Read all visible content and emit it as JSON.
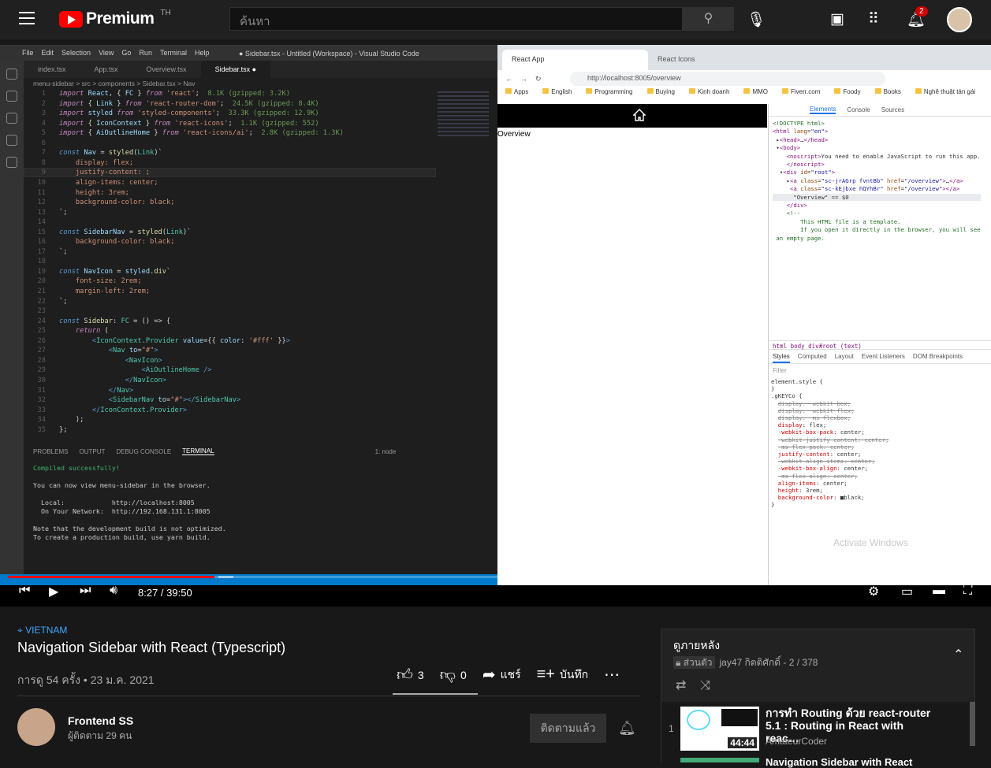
{
  "yt": {
    "logo_text": "Premium",
    "country_code": "TH",
    "search_placeholder": "ค้นหา",
    "notif_count": "2"
  },
  "vscode": {
    "menu": [
      "File",
      "Edit",
      "Selection",
      "View",
      "Go",
      "Run",
      "Terminal",
      "Help"
    ],
    "window_title": "● Sidebar.tsx - Untitled (Workspace) - Visual Studio Code",
    "tabs": [
      "index.tsx",
      "App.tsx",
      "Overview.tsx",
      "Sidebar.tsx ●"
    ],
    "breadcrumb": "menu-sidebar > src > components > Sidebar.tsx > Nav",
    "line_numbers": [
      "1",
      "2",
      "3",
      "4",
      "5",
      "6",
      "7",
      "8",
      "9",
      "10",
      "11",
      "12",
      "13",
      "14",
      "15",
      "16",
      "17",
      "18",
      "19",
      "20",
      "21",
      "22",
      "23",
      "24",
      "25",
      "26",
      "27",
      "28",
      "29",
      "30",
      "31",
      "32",
      "33",
      "34",
      "35"
    ],
    "terminal_tabs": [
      "PROBLEMS",
      "OUTPUT",
      "DEBUG CONSOLE",
      "TERMINAL"
    ],
    "terminal_select": "1: node",
    "terminal_lines": [
      "Compiled successfully!",
      "",
      "You can now view menu-sidebar in the browser.",
      "",
      "  Local:            http://localhost:8005",
      "  On Your Network:  http://192.168.131.1:8005",
      "",
      "Note that the development build is not optimized.",
      "To create a production build, use yarn build."
    ]
  },
  "chrome": {
    "tabs": [
      "React App",
      "React Icons"
    ],
    "url": "http://localhost:8005/overview",
    "bookmarks": [
      "Apps",
      "English",
      "Programming",
      "Buying",
      "Kinh doanh",
      "MMO",
      "Fiverr.com",
      "Foody",
      "Books",
      "Nghệ thuật tán gái"
    ],
    "page_text": "Overview"
  },
  "devtools": {
    "tabs": [
      "Elements",
      "Console",
      "Sources"
    ],
    "crumbs": "html  body  div#root  (text)",
    "style_tabs": [
      "Styles",
      "Computed",
      "Layout",
      "Event Listeners",
      "DOM Breakpoints"
    ],
    "filter": "Filter",
    "filter_right": ":hov  .cls",
    "watermark": "Activate Windows"
  },
  "player": {
    "time": "8:27 / 39:50",
    "progress": 0.212
  },
  "video": {
    "location": "VIETNAM",
    "title": "Navigation Sidebar with React (Typescript)",
    "meta": "การดู 54 ครั้ง • 23 ม.ค. 2021",
    "likes": "3",
    "dislikes": "0",
    "share": "แชร์",
    "save": "บันทึก",
    "channel": "Frontend SS",
    "subscribers": "ผู้ติดตาม 29 คน",
    "subscribe_btn": "ติดตามแล้ว"
  },
  "playlist": {
    "header": "ดูภายหลัง",
    "private": "ส่วนตัว",
    "meta": "jay47 กิตติศักดิ์ - 2 / 378",
    "item": {
      "index": "1",
      "title": "การทำ Routing ด้วย react-router 5.1 : Routing in React with reac…",
      "author": "AmateurCoder",
      "duration": "44:44"
    },
    "next_title": "Navigation Sidebar with React"
  }
}
